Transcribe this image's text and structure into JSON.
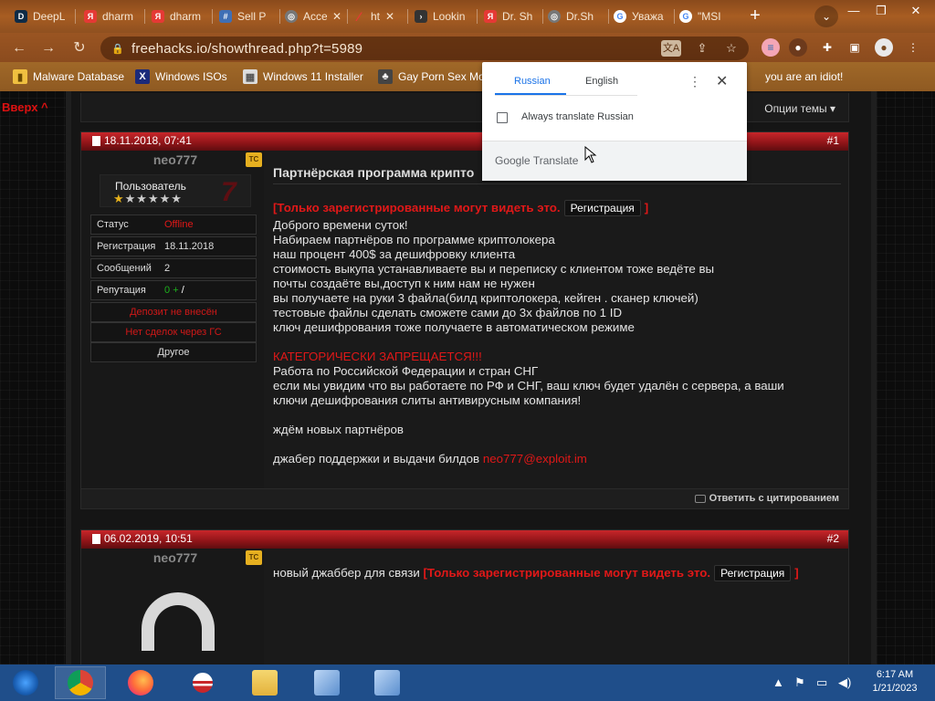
{
  "browser": {
    "tabs": [
      {
        "label": "DeepL",
        "icon": "deepl-icon"
      },
      {
        "label": "dharm",
        "icon": "yandex-icon"
      },
      {
        "label": "dharm",
        "icon": "yandex-icon"
      },
      {
        "label": "Sell P",
        "icon": "hash-icon"
      },
      {
        "label": "Acces",
        "icon": "globe-icon"
      },
      {
        "label": "ht",
        "icon": "slash-icon"
      },
      {
        "label": "Lookin",
        "icon": "terminal-icon"
      },
      {
        "label": "Dr. Sh",
        "icon": "yandex-icon"
      },
      {
        "label": "Dr.Sh",
        "icon": "globe-icon"
      },
      {
        "label": "Уважа",
        "icon": "google-icon"
      },
      {
        "label": "\"MSI",
        "icon": "google-icon"
      }
    ],
    "url": "freehacks.io/showthread.php?t=5989",
    "bookmarks": [
      {
        "label": "Malware Database",
        "icon": "folder-icon"
      },
      {
        "label": "Windows ISOs",
        "icon": "x-icon"
      },
      {
        "label": "Windows 11 Installer",
        "icon": "image-icon"
      },
      {
        "label": "Gay Porn Sex Mov",
        "icon": "game-icon"
      },
      {
        "label": "you are an idiot!",
        "icon": "smiley-icon"
      }
    ]
  },
  "translate_popup": {
    "tab_source": "Russian",
    "tab_target": "English",
    "checkbox_label": "Always translate Russian",
    "brand": "Google Translate"
  },
  "forum": {
    "up_link": "Вверх ^",
    "thread_tools": "Опции темы ▾",
    "quote_reply": "Ответить с цитированием",
    "posts": [
      {
        "date": "18.11.2018, 07:41",
        "number": "#1",
        "username": "neo777",
        "tc_badge": "TC",
        "rank": "Пользователь",
        "info": [
          {
            "key": "Статус",
            "value": "Offline"
          },
          {
            "key": "Регистрация",
            "value": "18.11.2018"
          },
          {
            "key": "Сообщений",
            "value": "2"
          },
          {
            "key": "Репутация",
            "value": "0",
            "suffix": "/"
          }
        ],
        "deposit": "Депозит не внесён",
        "deals": "Нет сделок через ГС",
        "other": "Другое",
        "title": "Партнёрская программа крипто",
        "reg_notice": "[Только зарегистрированные могут видеть это.",
        "reg_button": "Регистрация",
        "reg_close": "]",
        "lines": [
          "Доброго времени суток!",
          "Набираем партнёров по программе криптолокера",
          "наш процент 400$ за дешифровку клиента",
          "стоимость выкупа устанавливаете вы и переписку с клиентом тоже ведёте вы",
          "почты создаёте вы,доступ к ним нам не нужен",
          "вы получаете на руки 3 файла(билд криптолокера, кейген . сканер ключей)",
          "тестовые файлы сделать сможете сами до 3х файлов по 1 ID",
          "ключ дешифрования тоже получаете в автоматическом режиме"
        ],
        "warning": "КАТЕГОРИЧЕСКИ ЗАПРЕЩАЕТСЯ!!!",
        "lines2": [
          "Работа по Российской Федерации и стран СНГ",
          "если мы увидим что вы работаете по РФ и СНГ, ваш ключ будет удалён с сервера, а ваши",
          "ключи дешифрования слиты антивирусным компания!"
        ],
        "wait_line": "ждём новых партнёров",
        "jabber_prefix": "джабер поддержки и выдачи билдов",
        "jabber": "neo777@exploit.im"
      },
      {
        "date": "06.02.2019, 10:51",
        "number": "#2",
        "username": "neo777",
        "tc_badge": "TC",
        "text": "новый джаббер для связи",
        "reg_notice": "[Только зарегистрированные могут видеть это.",
        "reg_button": "Регистрация",
        "reg_close": "]"
      }
    ]
  },
  "taskbar": {
    "time": "6:17 AM",
    "date": "1/21/2023",
    "apps": [
      "start-button",
      "chrome",
      "firefox",
      "obama-icon",
      "file-explorer",
      "network-app",
      "network-app-2"
    ]
  },
  "colors": {
    "accent_red": "#e01818",
    "post_header": "#c8262a",
    "chrome_frame": "#8a4a1c",
    "translate_blue": "#1a73e8"
  }
}
